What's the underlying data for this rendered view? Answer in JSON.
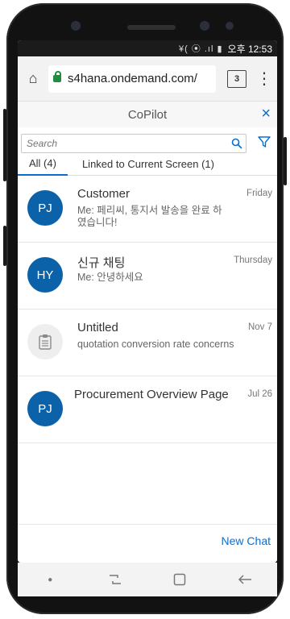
{
  "statusbar": {
    "icons": "¥( ⦿ .ıl ▮",
    "time": "오후 12:53"
  },
  "browser": {
    "home_icon": "home-icon",
    "url": "s4hana.ondemand.com/",
    "tab_count": "3",
    "menu_icon": "more-vert-icon"
  },
  "copilot": {
    "title": "CoPilot",
    "close": "×",
    "search_placeholder": "Search",
    "tabs": [
      {
        "label": "All (4)",
        "active": true
      },
      {
        "label": "Linked to Current Screen (1)",
        "active": false
      }
    ],
    "conversations": [
      {
        "initials": "PJ",
        "title": "Customer",
        "preview": "Me: 페리씨, 통지서 발송을 완료 하였습니다!",
        "date": "Friday"
      },
      {
        "initials": "HY",
        "title": "신규 채팅",
        "preview": "Me: 안녕하세요",
        "date": "Thursday"
      },
      {
        "initials": "",
        "title": "Untitled",
        "preview": "quotation conversion rate concerns",
        "date": "Nov 7",
        "icon": "clipboard-icon"
      },
      {
        "initials": "PJ",
        "title": "Procurement Overview Page",
        "preview": "",
        "date": "Jul 26"
      }
    ],
    "new_chat": "New Chat"
  }
}
